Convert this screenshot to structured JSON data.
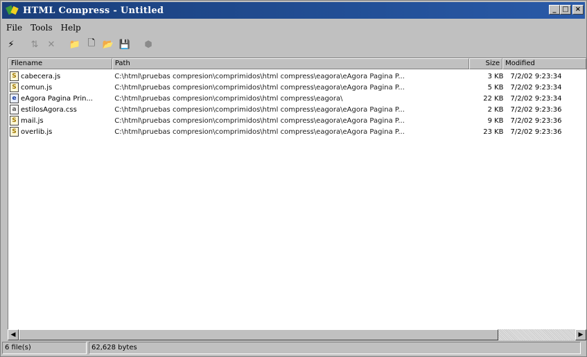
{
  "window": {
    "title": "HTML Compress - Untitled",
    "app_icon": "html-compress-icon",
    "buttons": {
      "minimize": "_",
      "maximize": "□",
      "close": "×"
    }
  },
  "menu": {
    "items": [
      {
        "label": "File",
        "name": "file"
      },
      {
        "label": "Tools",
        "name": "tools"
      },
      {
        "label": "Help",
        "name": "help"
      }
    ]
  },
  "toolbar": {
    "buttons": [
      {
        "name": "compress",
        "icon": "lightning-icon",
        "glyph": "⚡",
        "enabled": true
      },
      {
        "name": "sep1",
        "separator": true
      },
      {
        "name": "move",
        "icon": "move-icon",
        "glyph": "⇅",
        "enabled": false
      },
      {
        "name": "remove",
        "icon": "remove-x-icon",
        "glyph": "✕",
        "enabled": false
      },
      {
        "name": "sep2",
        "separator": true
      },
      {
        "name": "add-folder",
        "icon": "add-folder-icon",
        "glyph": "📁",
        "enabled": true
      },
      {
        "name": "new",
        "icon": "new-document-icon",
        "glyph": "🗋",
        "enabled": true
      },
      {
        "name": "open",
        "icon": "open-folder-icon",
        "glyph": "📂",
        "enabled": true
      },
      {
        "name": "save",
        "icon": "save-disk-icon",
        "glyph": "💾",
        "enabled": true
      },
      {
        "name": "sep3",
        "separator": true
      },
      {
        "name": "stop",
        "icon": "stop-icon",
        "glyph": "⬢",
        "enabled": false
      }
    ]
  },
  "columns": {
    "filename": "Filename",
    "path": "Path",
    "size": "Size",
    "modified": "Modified"
  },
  "files": [
    {
      "icon": "js-file-icon",
      "type": "js",
      "filename": "cabecera.js",
      "path": "C:\\html\\pruebas compresion\\comprimidos\\html compress\\eagora\\eAgora  Pagina P...",
      "size": "3 KB",
      "modified": "7/2/02 9:23:34"
    },
    {
      "icon": "js-file-icon",
      "type": "js",
      "filename": "comun.js",
      "path": "C:\\html\\pruebas compresion\\comprimidos\\html compress\\eagora\\eAgora  Pagina P...",
      "size": "5 KB",
      "modified": "7/2/02 9:23:34"
    },
    {
      "icon": "html-file-icon",
      "type": "html",
      "filename": "eAgora  Pagina Prin...",
      "path": "C:\\html\\pruebas compresion\\comprimidos\\html compress\\eagora\\",
      "size": "22 KB",
      "modified": "7/2/02 9:23:34"
    },
    {
      "icon": "css-file-icon",
      "type": "css",
      "filename": "estilosAgora.css",
      "path": "C:\\html\\pruebas compresion\\comprimidos\\html compress\\eagora\\eAgora  Pagina P...",
      "size": "2 KB",
      "modified": "7/2/02 9:23:36"
    },
    {
      "icon": "js-file-icon",
      "type": "js",
      "filename": "mail.js",
      "path": "C:\\html\\pruebas compresion\\comprimidos\\html compress\\eagora\\eAgora  Pagina P...",
      "size": "9 KB",
      "modified": "7/2/02 9:23:36"
    },
    {
      "icon": "js-file-icon",
      "type": "js",
      "filename": "overlib.js",
      "path": "C:\\html\\pruebas compresion\\comprimidos\\html compress\\eagora\\eAgora  Pagina P...",
      "size": "23 KB",
      "modified": "7/2/02 9:23:36"
    }
  ],
  "status": {
    "file_count": "6 file(s)",
    "total_bytes": "62,628 bytes"
  },
  "colors": {
    "titlebar": "#224f96",
    "chrome": "#c0c0c0"
  }
}
